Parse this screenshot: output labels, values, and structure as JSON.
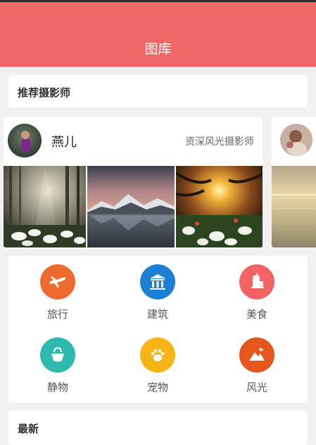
{
  "header": {
    "title": "图库"
  },
  "recommend": {
    "label": "推荐摄影师"
  },
  "photographer": {
    "name": "燕儿",
    "title": "资深风光摄影师"
  },
  "categories": [
    {
      "label": "旅行",
      "icon": "airplane-icon",
      "color": "#ef6a2e"
    },
    {
      "label": "建筑",
      "icon": "building-icon",
      "color": "#1b7fd6"
    },
    {
      "label": "美食",
      "icon": "food-icon",
      "color": "#f26464"
    },
    {
      "label": "静物",
      "icon": "still-life-icon",
      "color": "#2fb8b0"
    },
    {
      "label": "宠物",
      "icon": "paw-icon",
      "color": "#f6b514"
    },
    {
      "label": "风光",
      "icon": "landscape-icon",
      "color": "#e5561f"
    }
  ],
  "latest": {
    "label": "最新"
  },
  "colors": {
    "header": "#f06767",
    "background": "#f1f1f1"
  }
}
